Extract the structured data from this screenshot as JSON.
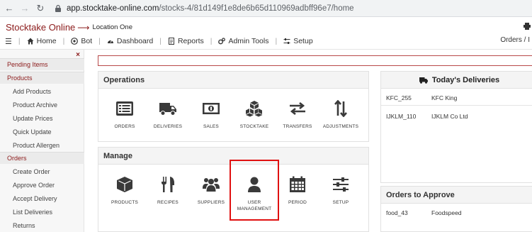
{
  "browser": {
    "url_host": "app.stocktake-online.com",
    "url_path": "/stocks-4/81d149f1e8de6b65d110969adbff96e7/home"
  },
  "header": {
    "brand": "Stocktake Online",
    "location": "Location One",
    "menu": {
      "home": "Home",
      "bot": "Bot",
      "dashboard": "Dashboard",
      "reports": "Reports",
      "admin_tools": "Admin Tools",
      "setup": "Setup"
    },
    "right_text": "Orders / I"
  },
  "sidebar": {
    "close_glyph": "×",
    "items": [
      {
        "label": "Pending Items",
        "type": "section"
      },
      {
        "label": "Products",
        "type": "section"
      },
      {
        "label": "Add Products",
        "type": "sub"
      },
      {
        "label": "Product Archive",
        "type": "sub"
      },
      {
        "label": "Update Prices",
        "type": "sub"
      },
      {
        "label": "Quick Update",
        "type": "sub"
      },
      {
        "label": "Product Allergen",
        "type": "sub"
      },
      {
        "label": "Orders",
        "type": "section"
      },
      {
        "label": "Create Order",
        "type": "sub"
      },
      {
        "label": "Approve Order",
        "type": "sub"
      },
      {
        "label": "Accept Delivery",
        "type": "sub"
      },
      {
        "label": "List Deliveries",
        "type": "sub"
      },
      {
        "label": "Returns",
        "type": "sub"
      }
    ]
  },
  "operations": {
    "title": "Operations",
    "tiles": [
      {
        "label": "ORDERS",
        "icon": "list-icon"
      },
      {
        "label": "DELIVERIES",
        "icon": "truck-icon"
      },
      {
        "label": "SALES",
        "icon": "money-icon"
      },
      {
        "label": "STOCKTAKE",
        "icon": "cubes-icon"
      },
      {
        "label": "TRANSFERS",
        "icon": "exchange-icon"
      },
      {
        "label": "ADJUSTMENTS",
        "icon": "sort-arrows-icon"
      }
    ]
  },
  "manage": {
    "title": "Manage",
    "tiles": [
      {
        "label": "PRODUCTS",
        "icon": "cube-icon"
      },
      {
        "label": "RECIPES",
        "icon": "utensils-icon"
      },
      {
        "label": "SUPPLIERS",
        "icon": "users-icon"
      },
      {
        "label": "USER MANAGEMENT",
        "label_line1": "USER",
        "label_line2": "MANAGEMENT",
        "icon": "user-icon"
      },
      {
        "label": "PERIOD",
        "icon": "calendar-icon"
      },
      {
        "label": "SETUP",
        "icon": "sliders-icon"
      }
    ]
  },
  "deliveries": {
    "title": "Today's Deliveries",
    "rows": [
      {
        "code": "KFC_255",
        "name": "KFC King"
      },
      {
        "code": "IJKLM_110",
        "name": "IJKLM Co Ltd"
      }
    ]
  },
  "orders_to_approve": {
    "title": "Orders to Approve",
    "rows": [
      {
        "code": "food_43",
        "name": "Foodspeed"
      }
    ]
  },
  "colors": {
    "brand": "#8b1a1a",
    "highlight": "#e01010"
  }
}
